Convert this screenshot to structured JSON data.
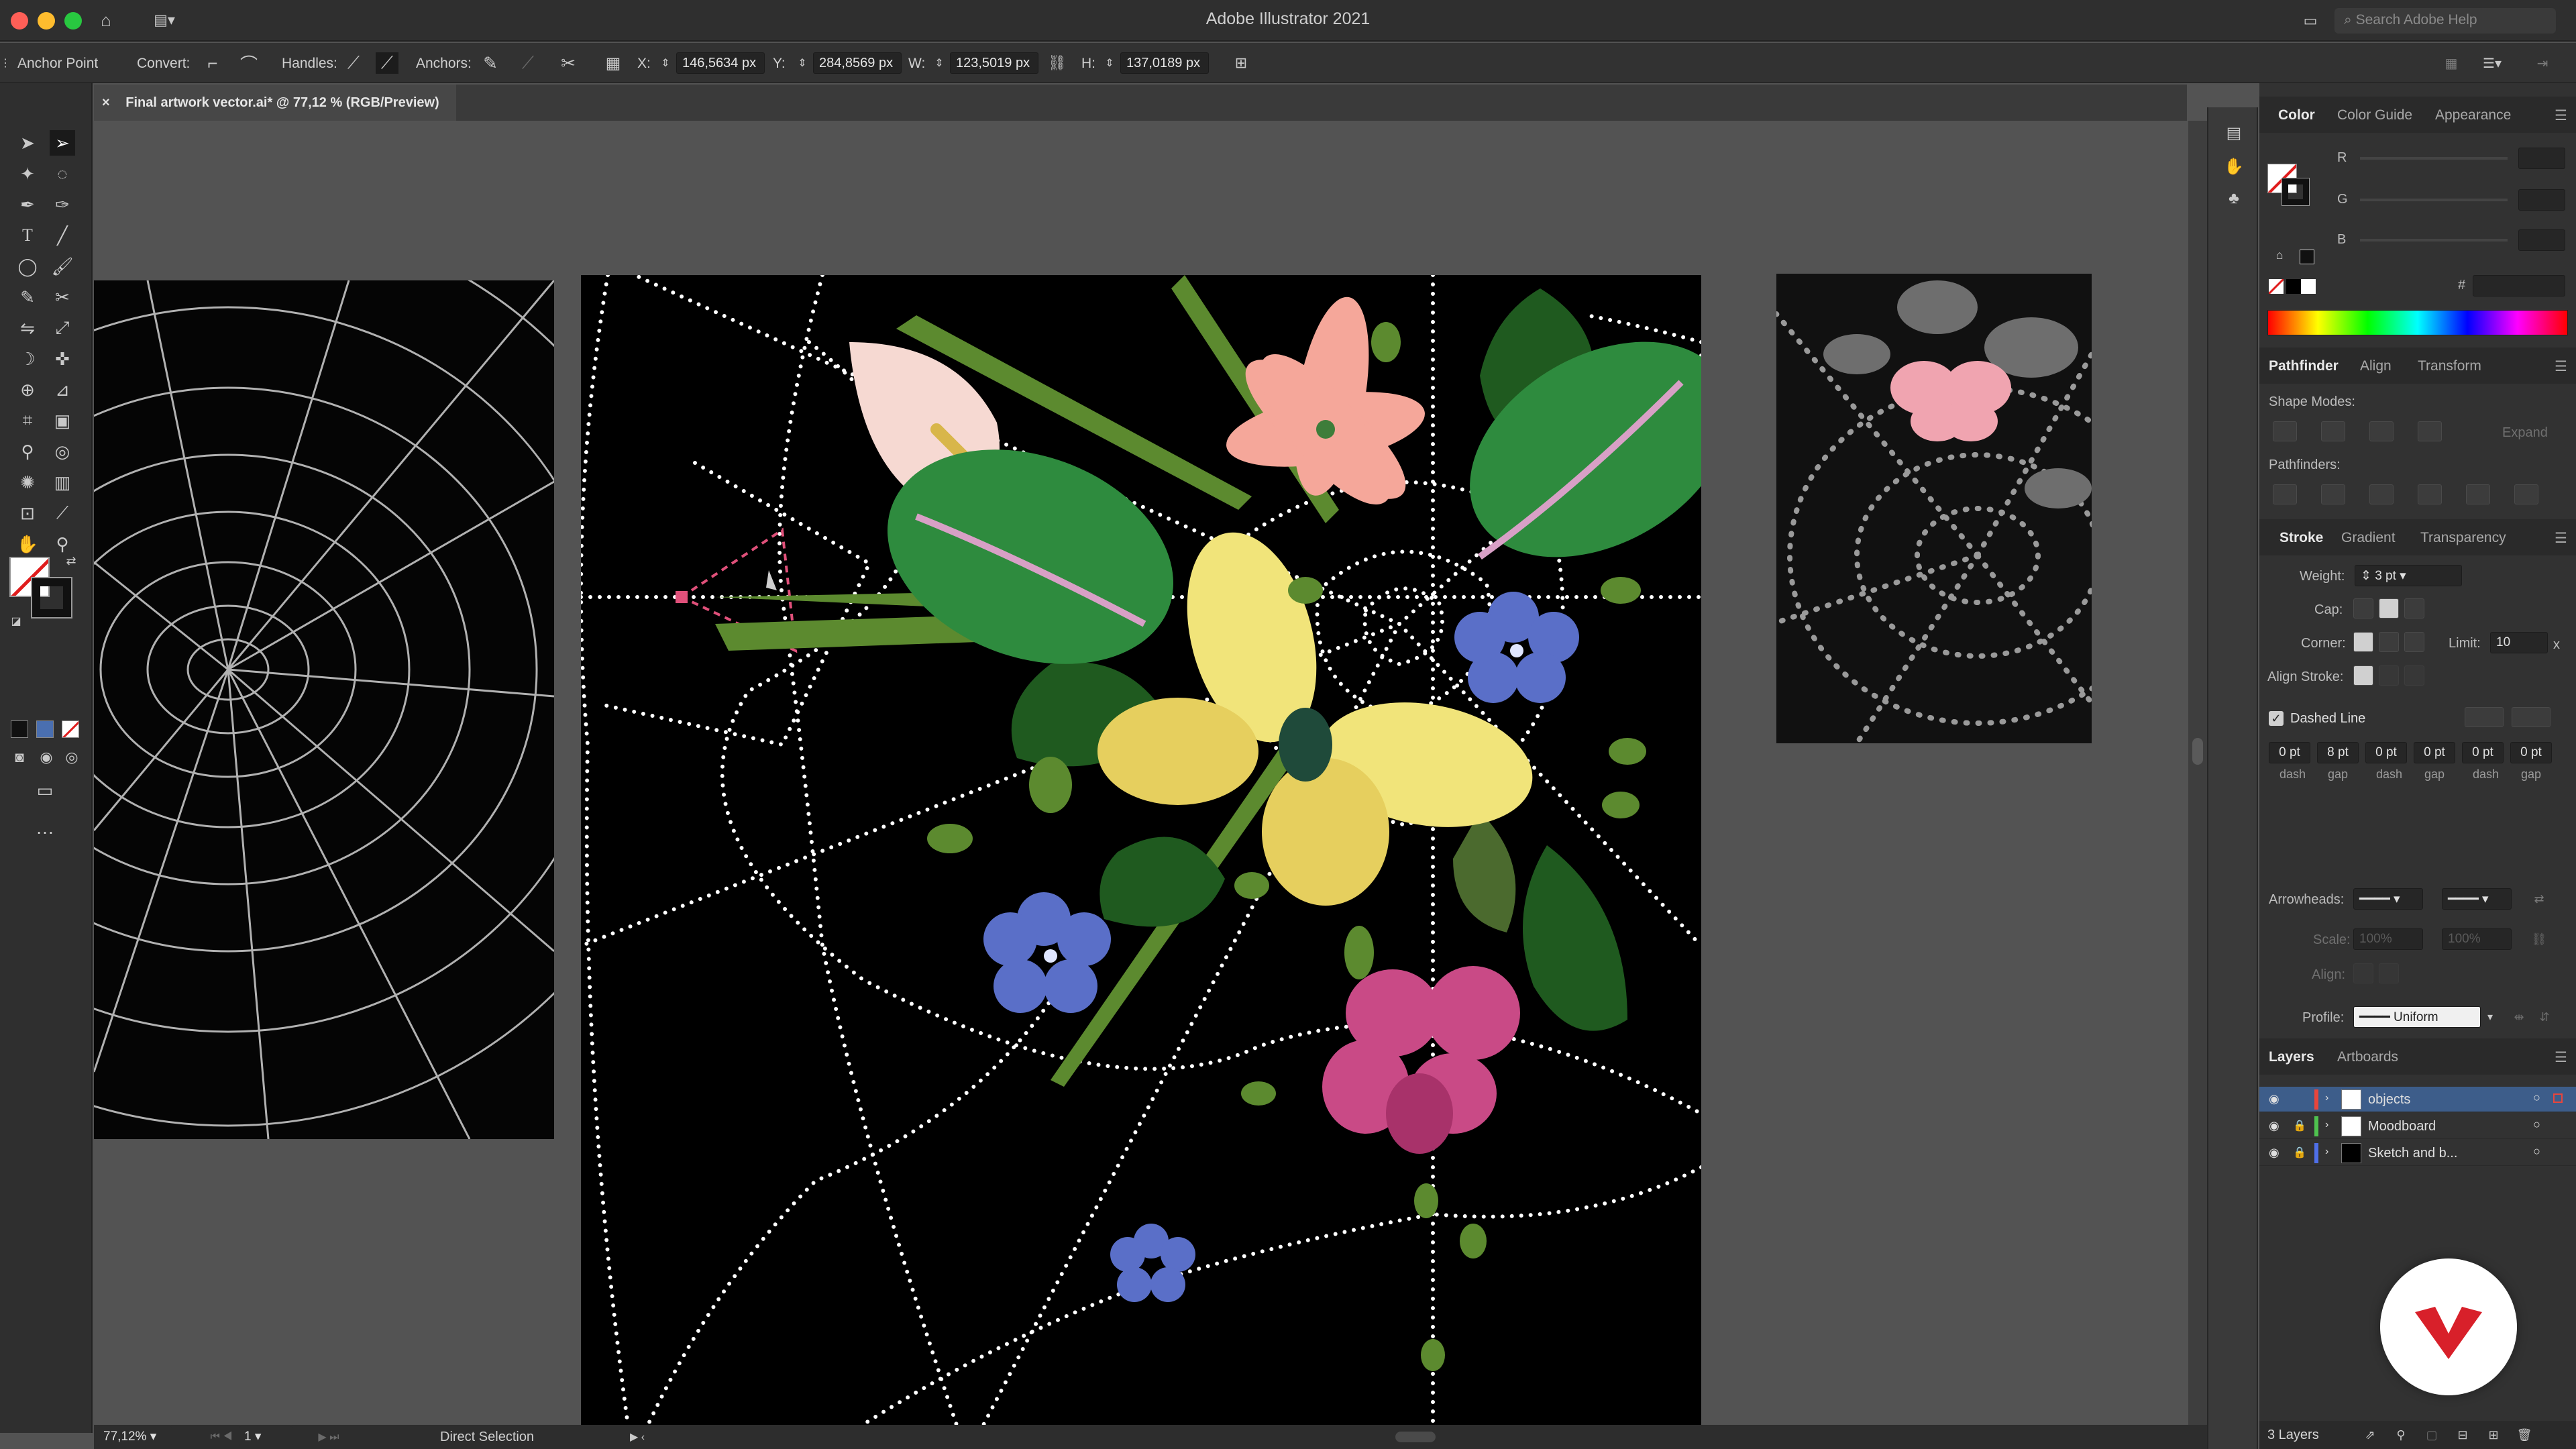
{
  "app": {
    "title": "Adobe Illustrator 2021",
    "search_placeholder": "Search Adobe Help"
  },
  "control_bar": {
    "mode_label": "Anchor Point",
    "convert_label": "Convert:",
    "handles_label": "Handles:",
    "anchors_label": "Anchors:",
    "x_label": "X:",
    "x_value": "146,5634 px",
    "y_label": "Y:",
    "y_value": "284,8569 px",
    "w_label": "W:",
    "w_value": "123,5019 px",
    "h_label": "H:",
    "h_value": "137,0189 px"
  },
  "document": {
    "tab_title": "Final artwork vector.ai* @ 77,12 % (RGB/Preview)",
    "close_glyph": "×"
  },
  "status": {
    "zoom": "77,12%",
    "artboard": "1",
    "tool": "Direct Selection"
  },
  "color_panel": {
    "tabs": [
      "Color",
      "Color Guide",
      "Appearance"
    ],
    "r": "R",
    "g": "G",
    "b": "B",
    "hash": "#"
  },
  "pathfinder_panel": {
    "tabs": [
      "Pathfinder",
      "Align",
      "Transform"
    ],
    "shape_modes_label": "Shape Modes:",
    "expand_label": "Expand",
    "pathfinders_label": "Pathfinders:"
  },
  "stroke_panel": {
    "tabs": [
      "Stroke",
      "Gradient",
      "Transparency"
    ],
    "weight_label": "Weight:",
    "weight_value": "3 pt",
    "cap_label": "Cap:",
    "corner_label": "Corner:",
    "limit_label": "Limit:",
    "limit_value": "10",
    "limit_x": "x",
    "align_stroke_label": "Align Stroke:",
    "dashed_line_label": "Dashed Line",
    "dash_values": [
      {
        "value": "0 pt",
        "kind": "dash"
      },
      {
        "value": "8 pt",
        "kind": "gap"
      },
      {
        "value": "0 pt",
        "kind": "dash"
      },
      {
        "value": "0 pt",
        "kind": "gap"
      },
      {
        "value": "0 pt",
        "kind": "dash"
      },
      {
        "value": "0 pt",
        "kind": "gap"
      }
    ],
    "arrowheads_label": "Arrowheads:",
    "scale_label": "Scale:",
    "scale_value_1": "100%",
    "scale_value_2": "100%",
    "align_label": "Align:",
    "profile_label": "Profile:",
    "profile_value": "Uniform"
  },
  "layers_panel": {
    "tabs": [
      "Layers",
      "Artboards"
    ],
    "layers": [
      {
        "name": "objects",
        "color": "#e8453c",
        "locked": false,
        "selected": true
      },
      {
        "name": "Moodboard",
        "color": "#4fc24f",
        "locked": true,
        "selected": false
      },
      {
        "name": "Sketch and b...",
        "color": "#4f6fe8",
        "locked": true,
        "selected": false
      }
    ],
    "footer_count": "3 Layers"
  },
  "colors": {
    "accent_selection": "#3d5d8a",
    "brand_logo": "#d8202a"
  }
}
